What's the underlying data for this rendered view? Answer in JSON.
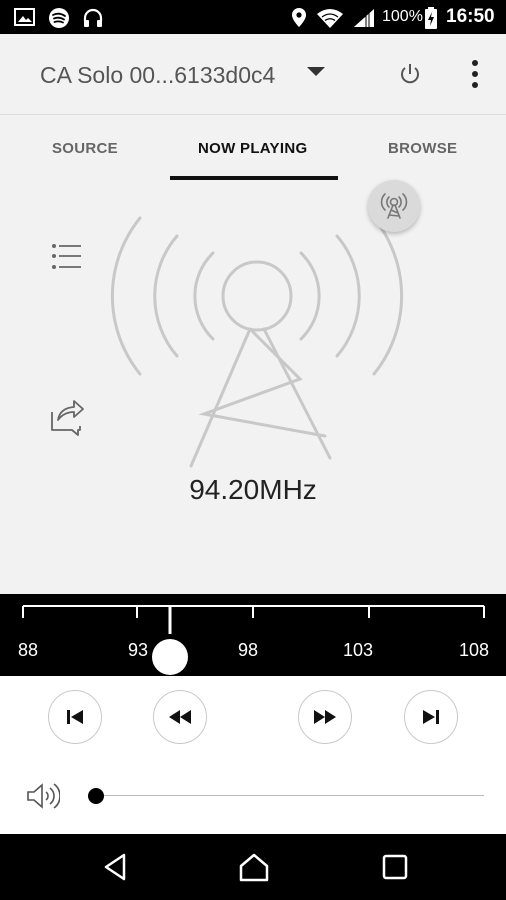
{
  "status_bar": {
    "icons": [
      "image-icon",
      "spotify-icon",
      "headphones-icon",
      "location-icon",
      "wifi-icon",
      "signal-icon",
      "battery-icon"
    ],
    "battery_percent": "100%",
    "time": "16:50"
  },
  "app_bar": {
    "device_name": "CA Solo 00...6133d0c4",
    "icons": [
      "chevron-down-icon",
      "power-icon",
      "more-vert-icon"
    ]
  },
  "tabs": [
    {
      "label": "SOURCE",
      "active": false
    },
    {
      "label": "NOW PLAYING",
      "active": true
    },
    {
      "label": "BROWSE",
      "active": false
    }
  ],
  "now_playing": {
    "frequency": "94.20MHz",
    "icons": [
      "radio-mode-icon",
      "playlist-icon",
      "share-icon",
      "radio-tower-icon"
    ]
  },
  "tuner": {
    "tick_labels": [
      "88",
      "93",
      "98",
      "103",
      "108"
    ],
    "current_mhz": 94.2,
    "range_mhz": [
      88,
      108
    ]
  },
  "controls": {
    "icons": [
      "skip-previous-icon",
      "rewind-icon",
      "fast-forward-icon",
      "skip-next-icon"
    ],
    "volume_level": 0.0
  },
  "nav_bar": {
    "icons": [
      "back-icon",
      "home-icon",
      "recents-icon"
    ]
  },
  "colors": {
    "background": "#f2f2f2",
    "tuner_bg": "#000000",
    "accent": "#111111"
  }
}
